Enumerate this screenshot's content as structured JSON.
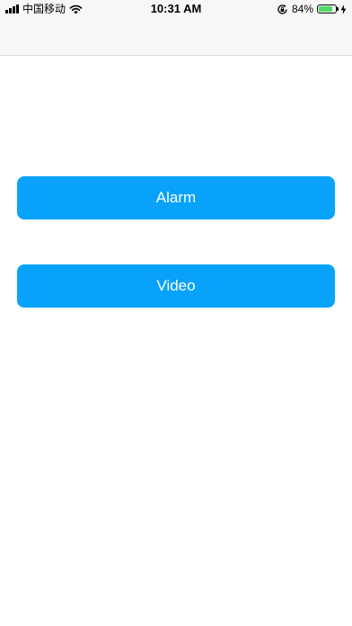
{
  "status_bar": {
    "carrier": "中国移动",
    "time": "10:31 AM",
    "battery_percent": "84%",
    "battery_level": 0.84,
    "battery_color": "#4cd964",
    "icons": [
      "signal-icon",
      "wifi-icon",
      "orientation-lock-icon",
      "battery-icon",
      "charging-bolt-icon"
    ]
  },
  "buttons": {
    "alarm_label": "Alarm",
    "video_label": "Video",
    "color": "#08a2fb"
  }
}
